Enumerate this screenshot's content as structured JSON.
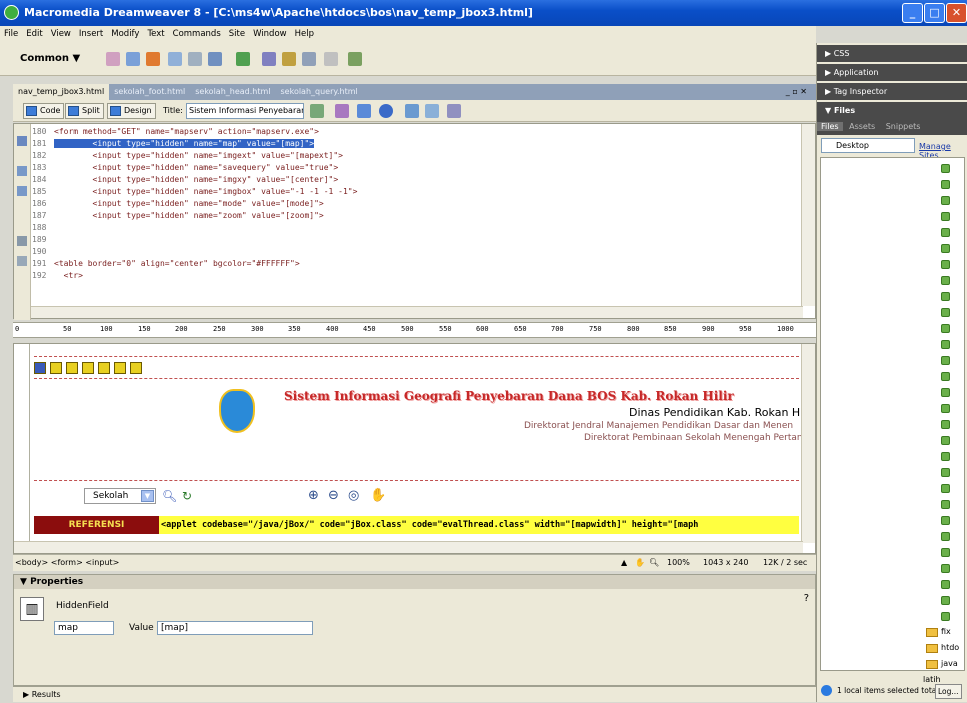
{
  "window": {
    "title": "Macromedia Dreamweaver 8 - [C:\\ms4w\\Apache\\htdocs\\bos\\nav_temp_jbox3.html]"
  },
  "menu": [
    "File",
    "Edit",
    "View",
    "Insert",
    "Modify",
    "Text",
    "Commands",
    "Site",
    "Window",
    "Help"
  ],
  "insert_bar": {
    "category": "Common ▼"
  },
  "doc_tabs": [
    "nav_temp_jbox3.html",
    "sekolah_foot.html",
    "sekolah_head.html",
    "sekolah_query.html"
  ],
  "doc_toolbar": {
    "code_label": "Code",
    "split_label": "Split",
    "design_label": "Design",
    "title_label": "Title:",
    "title_value": "Sistem Informasi Penyebaran I"
  },
  "code_lines": [
    {
      "n": "180",
      "pre": "<form method=\"GET\" name=\"mapserv\" action=\"mapserv.exe\">"
    },
    {
      "n": "181",
      "pre": "        <input type=\"hidden\" name=\"map\" value=\"[map]\">"
    },
    {
      "n": "182",
      "pre": "        <input type=\"hidden\" name=\"imgext\" value=\"[mapext]\">"
    },
    {
      "n": "183",
      "pre": "        <input type=\"hidden\" name=\"savequery\" value=\"true\">"
    },
    {
      "n": "184",
      "pre": "        <input type=\"hidden\" name=\"imgxy\" value=\"[center]\">"
    },
    {
      "n": "185",
      "pre": "        <input type=\"hidden\" name=\"imgbox\" value=\"-1 -1 -1 -1\">"
    },
    {
      "n": "186",
      "pre": "        <input type=\"hidden\" name=\"mode\" value=\"[mode]\">"
    },
    {
      "n": "187",
      "pre": "        <input type=\"hidden\" name=\"zoom\" value=\"[zoom]\">"
    },
    {
      "n": "188",
      "pre": ""
    },
    {
      "n": "189",
      "pre": ""
    },
    {
      "n": "190",
      "pre": ""
    },
    {
      "n": "191",
      "pre": "<table border=\"0\" align=\"center\" bgcolor=\"#FFFFFF\">"
    },
    {
      "n": "192",
      "pre": "  <tr>"
    }
  ],
  "ruler_ticks": [
    "0",
    "50",
    "100",
    "150",
    "200",
    "250",
    "300",
    "350",
    "400",
    "450",
    "500",
    "550",
    "600",
    "650",
    "700",
    "750",
    "800",
    "850",
    "900",
    "950",
    "1000"
  ],
  "design": {
    "site_title": "Sistem Informasi Geografi Penyebaran Dana BOS Kab. Rokan Hilir",
    "dinas": "Dinas Pendidikan Kab. Rokan H",
    "dirjen1": "Direktorat Jendral Manajemen Pendidikan Dasar dan Menen",
    "dirjen2": "Direktorat Pembinaan Sekolah Menengah Pertan",
    "select_value": "Sekolah",
    "ref_label": "REFERENSI",
    "applet_code": "<applet codebase=\"/java/jBox/\" code=\"jBox.class\" code=\"evalThread.class\" width=\"[mapwidth]\" height=\"[maph"
  },
  "status": {
    "tag_path": "<body> <form> <input>",
    "zoom": "100%",
    "size": "1043 x 240",
    "download": "12K / 2 sec"
  },
  "properties": {
    "header": "Properties",
    "type_label": "HiddenField",
    "name_value": "map",
    "value_label": "Value",
    "value_value": "[map]"
  },
  "results_label": "Results",
  "right_panel": {
    "css": "CSS",
    "application": "Application",
    "tag_inspector": "Tag Inspector",
    "files": "Files",
    "tabs": [
      "Files",
      "Assets",
      "Snippets"
    ],
    "location": "Desktop",
    "manage_sites": "Manage Sites",
    "folders": [
      "fix",
      "htdo",
      "java",
      "latih"
    ],
    "status": "1 local items selected tota",
    "log_button": "Log..."
  }
}
